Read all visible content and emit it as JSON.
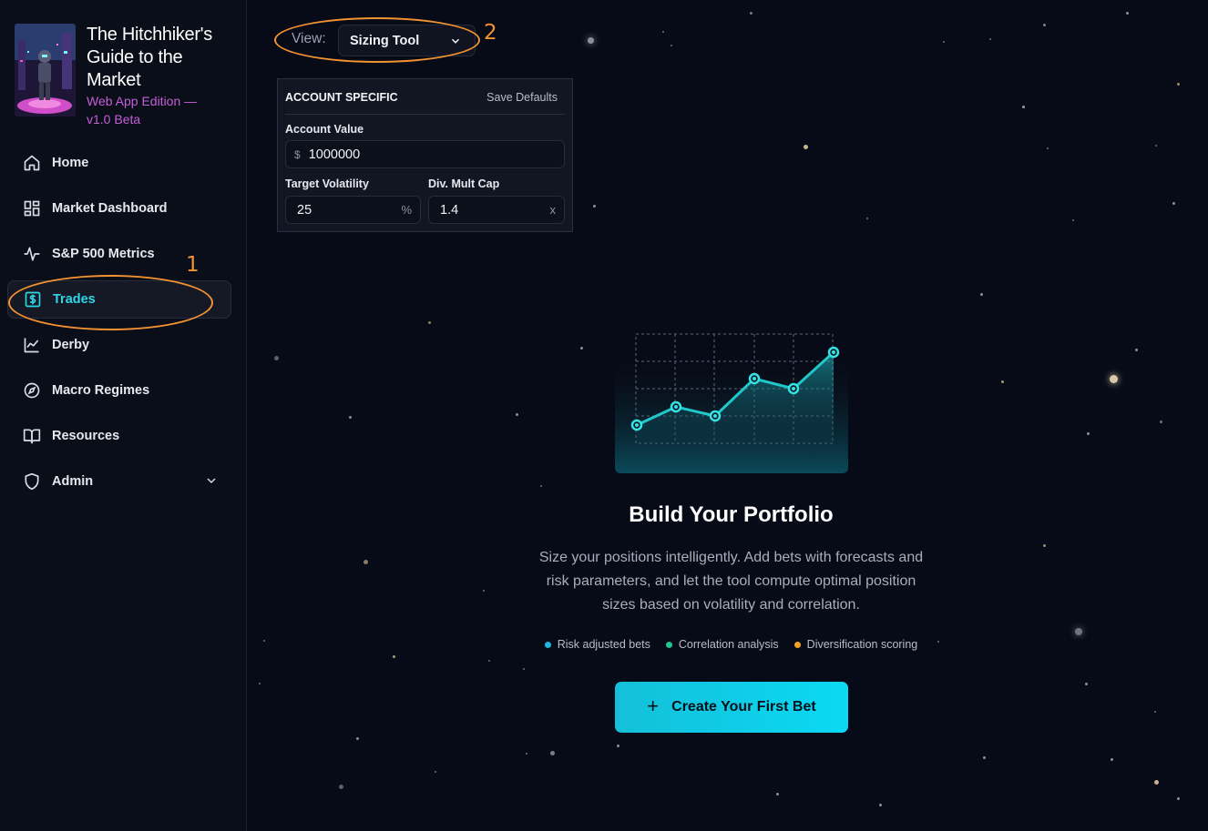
{
  "sidebar": {
    "brand_title": "The Hitchhiker's Guide to the Market",
    "brand_subtitle": "Web App Edition — v1.0 Beta",
    "items": [
      {
        "label": "Home",
        "icon": "home-icon"
      },
      {
        "label": "Market Dashboard",
        "icon": "dashboard-grid-icon"
      },
      {
        "label": "S&P 500 Metrics",
        "icon": "activity-pulse-icon"
      },
      {
        "label": "Trades",
        "icon": "dollar-square-icon",
        "active": true
      },
      {
        "label": "Derby",
        "icon": "line-chart-icon"
      },
      {
        "label": "Macro Regimes",
        "icon": "compass-icon"
      },
      {
        "label": "Resources",
        "icon": "book-open-icon"
      },
      {
        "label": "Admin",
        "icon": "shield-icon",
        "expandable": true
      }
    ]
  },
  "annotations": {
    "one": "1",
    "two": "2"
  },
  "view": {
    "label": "View:",
    "selected": "Sizing Tool"
  },
  "account_panel": {
    "title": "ACCOUNT SPECIFIC",
    "save_label": "Save Defaults",
    "account_value": {
      "label": "Account Value",
      "prefix": "$",
      "value": "1000000"
    },
    "target_volatility": {
      "label": "Target Volatility",
      "value": "25",
      "suffix": "%"
    },
    "div_mult_cap": {
      "label": "Div. Mult Cap",
      "value": "1.4",
      "suffix": "x"
    }
  },
  "hero": {
    "title": "Build Your Portfolio",
    "description": "Size your positions intelligently. Add bets with forecasts and risk parameters, and let the tool compute optimal position sizes based on volatility and correlation.",
    "features": [
      {
        "label": "Risk adjusted bets",
        "color": "#1fb6e0"
      },
      {
        "label": "Correlation analysis",
        "color": "#22c58b"
      },
      {
        "label": "Diversification scoring",
        "color": "#f5a024"
      }
    ],
    "cta_label": "Create Your First Bet"
  },
  "colors": {
    "accent": "#2fd6e6",
    "annotation": "#f39232",
    "brand_sub": "#c75dd9"
  }
}
